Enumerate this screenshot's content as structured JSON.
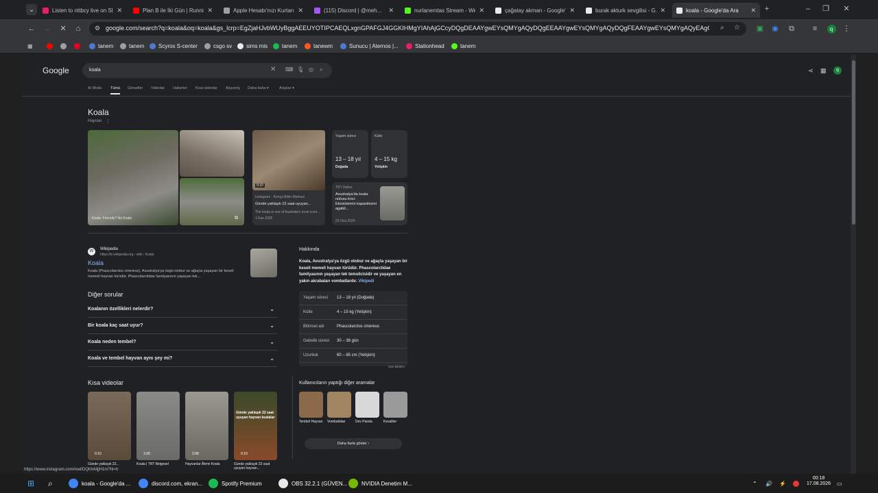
{
  "tabs": [
    {
      "title": "Listen to nttbcy live on Sl...",
      "color": "#e91e63"
    },
    {
      "title": "Plan B ile İki Gün | Runnin...",
      "color": "#ff0000"
    },
    {
      "title": "Apple Hesabı'nızı Kurtarın",
      "color": "#9aa0a6"
    },
    {
      "title": "(115) Discord | @meh...",
      "color": "#a855f7"
    },
    {
      "title": "nurlanemtas Stream - We...",
      "color": "#53fc18"
    },
    {
      "title": "çağatay akman - Google'...",
      "color": "#e8eaed"
    },
    {
      "title": "burak akturk sevgilisi - G...",
      "color": "#e8eaed"
    },
    {
      "title": "koala - Google'da Ara",
      "color": "#e8eaed"
    }
  ],
  "new_tab_label": "+",
  "address_bar": {
    "url": "google.com/search?q=koala&oq=koala&gs_lcrp=EgZjaHJvbWUyBggAEEUYOTIPCAEQLxgnGPAFGJ4GGKIHMgYIAhAjGCcyDQgDEAAYgwEYsQMYgAQyDQgEEAAYgwEYsQMYgAQyDQgFEAAYgwEYsQMYgAQyEAgGEAAYgwEYsQMYQMY..."
  },
  "bookmarks": [
    {
      "label": "",
      "color": "#ff0000"
    },
    {
      "label": "",
      "color": "#9aa0a6"
    },
    {
      "label": "",
      "color": "#e60023"
    },
    {
      "label": "tanem",
      "color": "#4a7bd0"
    },
    {
      "label": "tanem",
      "color": "#9aa0a6"
    },
    {
      "label": "Scyrox S-center",
      "color": "#4a7bd0"
    },
    {
      "label": "csgo sv",
      "color": "#9aa0a6"
    },
    {
      "label": "sims mis",
      "color": "#e8eaed"
    },
    {
      "label": "tanem",
      "color": "#1db954"
    },
    {
      "label": "tanewm",
      "color": "#ff5722"
    },
    {
      "label": "Sunucu | Aternos |...",
      "color": "#4a7bd0"
    },
    {
      "label": "Stationhead",
      "color": "#e91e63"
    },
    {
      "label": "tanem",
      "color": "#53fc18"
    }
  ],
  "google": {
    "logo": "Google",
    "query": "koala",
    "avatar_letter": "q",
    "filters": [
      "AI Modu",
      "Tümü",
      "Görseller",
      "Videolar",
      "Haberler",
      "Kısa videolar",
      "Alışveriş",
      "Daha fazla ▾",
      "Araçlar ▾"
    ],
    "entity_title": "Koala",
    "entity_subtitle": "Hayvan",
    "image_caption": "Koala: Friendly? No Koala",
    "facts_cards": [
      {
        "label": "Yaşam süresi",
        "value": "13 – 18 yıl",
        "sub": "Doğada"
      },
      {
        "label": "Kütle",
        "value": "4 – 15 kg",
        "sub": "Yetişkin"
      }
    ],
    "video_card": {
      "duration": "0:10",
      "source": "Instagram · Konya Bilim Merkezi",
      "title": "Günde yaklaşık 22 saat uyuyan...",
      "desc": "The koala is one of Australia's most iconi...",
      "date": "1 Kas 2025"
    },
    "news_card": {
      "source": "TRT Haber",
      "title": "Avustralya'da koala nüfusu krizi: Ekosistemin kapasitesini agabil...",
      "date": "23 Oca 2026"
    },
    "wiki": {
      "source": "Wikipedia",
      "url": "https://tr.wikipedia.org › wiki › Koala",
      "title": "Koala",
      "snippet": "Koala (Phascolarctos cinereus), Avustralya'ya özgü otobur ve ağaçta yaşayan bir keseli memeli hayvan türüdür. Phascolarctidae familyasının yaşayan tek..."
    },
    "others_title": "Diğer sorular",
    "questions": [
      "Koalanın özellikleri nelerdir?",
      "Bir koala kaç saat uyur?",
      "Koala neden tembel?",
      "Koala ve tembel hayvan aynı şey mi?"
    ],
    "about_title": "Hakkında",
    "about_text": "Koala, Avustralya'ya özgü otobur ve ağaçta yaşayan bir keseli memeli hayvan türüdür. Phascolarctidae familyasının yaşayan tek temsilcisidir ve yaşayan en yakın akrabaları vombatlardır.",
    "about_link": "Vikipedi",
    "facts": [
      {
        "k": "Yaşam süresi",
        "v": "13 – 18 yıl (Doğada)"
      },
      {
        "k": "Kütle",
        "v": "4 – 15 kg (Yetişkin)"
      },
      {
        "k": "Bilimsel adı",
        "v": "Phascolarctos cinereus"
      },
      {
        "k": "Gebelik süresi",
        "v": "30 – 38 gün"
      },
      {
        "k": "Uzunluk",
        "v": "60 – 85 cm (Yetişkin)"
      }
    ],
    "feedback": "Geri bildirim",
    "short_videos_title": "Kısa videolar",
    "short_videos": [
      {
        "dur": "0:10",
        "title": "Günde yaklaşık 22..."
      },
      {
        "dur": "1:00",
        "title": "Koala | TRT Belgesel"
      },
      {
        "dur": "2:08",
        "title": "Hayvanlar Âlemi Koala"
      },
      {
        "dur": "0:10",
        "title": "Günde yaklaşık 22 saat uyuyan hayvan..."
      }
    ],
    "short_overlay": "Günde yaklaşık 22 saat uyuyan hayvan koalalar",
    "related_title": "Kullanıcıların yaptığı diğer aramalar",
    "related": [
      {
        "label": "Tembel Hayvan",
        "color": "#8a6a4a"
      },
      {
        "label": "Vombatidae",
        "color": "#a08562"
      },
      {
        "label": "Dev Panda",
        "color": "#d8d8d8"
      },
      {
        "label": "Kesaliler",
        "color": "#9a9a9a"
      }
    ],
    "show_more": "Daha fazla göster ›"
  },
  "status_url": "https://www.instagram.com/reel/DQhIvMjjH1n/?hl=tr",
  "taskbar": {
    "apps": [
      {
        "label": "koala - Google'da ...",
        "color": "#4285f4"
      },
      {
        "label": "discord.com, ekran...",
        "color": "#4285f4"
      },
      {
        "label": "Spotify Premium",
        "color": "#1db954"
      },
      {
        "label": "OBS 32.2.1 (GÜVEN...",
        "color": "#e8eaed"
      },
      {
        "label": "NVIDIA Denetim M...",
        "color": "#76b900"
      }
    ],
    "time": "00:18",
    "date": "17.08.2026"
  }
}
